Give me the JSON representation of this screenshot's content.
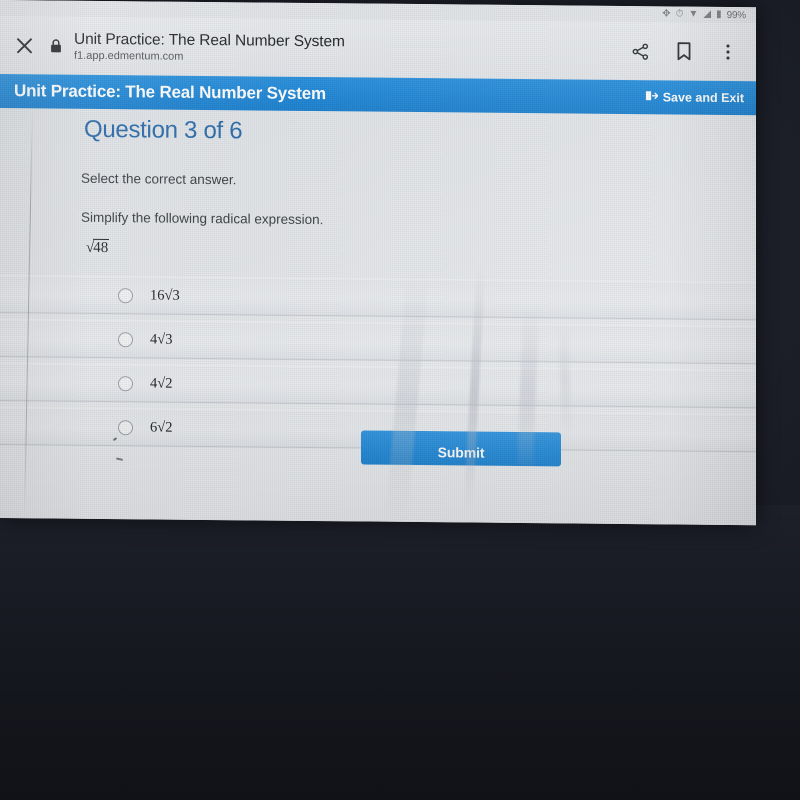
{
  "device": {
    "status_bar": {
      "icons": [
        "bluetooth-icon",
        "alarm-icon",
        "wifi-icon",
        "signal-icon",
        "battery-icon"
      ],
      "battery_percent": "99%"
    }
  },
  "browser": {
    "close_label": "✕",
    "security_icon": "lock-icon",
    "tab_title": "Unit Practice: The Real Number System",
    "tab_url": "f1.app.edmentum.com",
    "actions": [
      {
        "name": "share-icon",
        "label": "Share"
      },
      {
        "name": "bookmark-icon",
        "label": "Bookmark"
      },
      {
        "name": "overflow-menu-icon",
        "label": "More options"
      }
    ]
  },
  "app_header": {
    "title": "Unit Practice: The Real Number System",
    "save_exit_label": "Save and Exit",
    "save_exit_icon": "exit-arrow-icon",
    "accent_color": "#2189d6"
  },
  "quiz": {
    "question_heading": "Question 3 of 6",
    "question_number": 3,
    "question_total": 6,
    "heading_color": "#2b6cab",
    "instruction": "Select the correct answer.",
    "prompt": "Simplify the following radical expression.",
    "expression": {
      "coefficient": "",
      "radicand": "48"
    },
    "options": [
      {
        "coefficient": "16",
        "radicand": "3",
        "selected": false
      },
      {
        "coefficient": "4",
        "radicand": "3",
        "selected": false
      },
      {
        "coefficient": "4",
        "radicand": "2",
        "selected": false
      },
      {
        "coefficient": "6",
        "radicand": "2",
        "selected": false
      }
    ],
    "submit_label": "Submit"
  }
}
